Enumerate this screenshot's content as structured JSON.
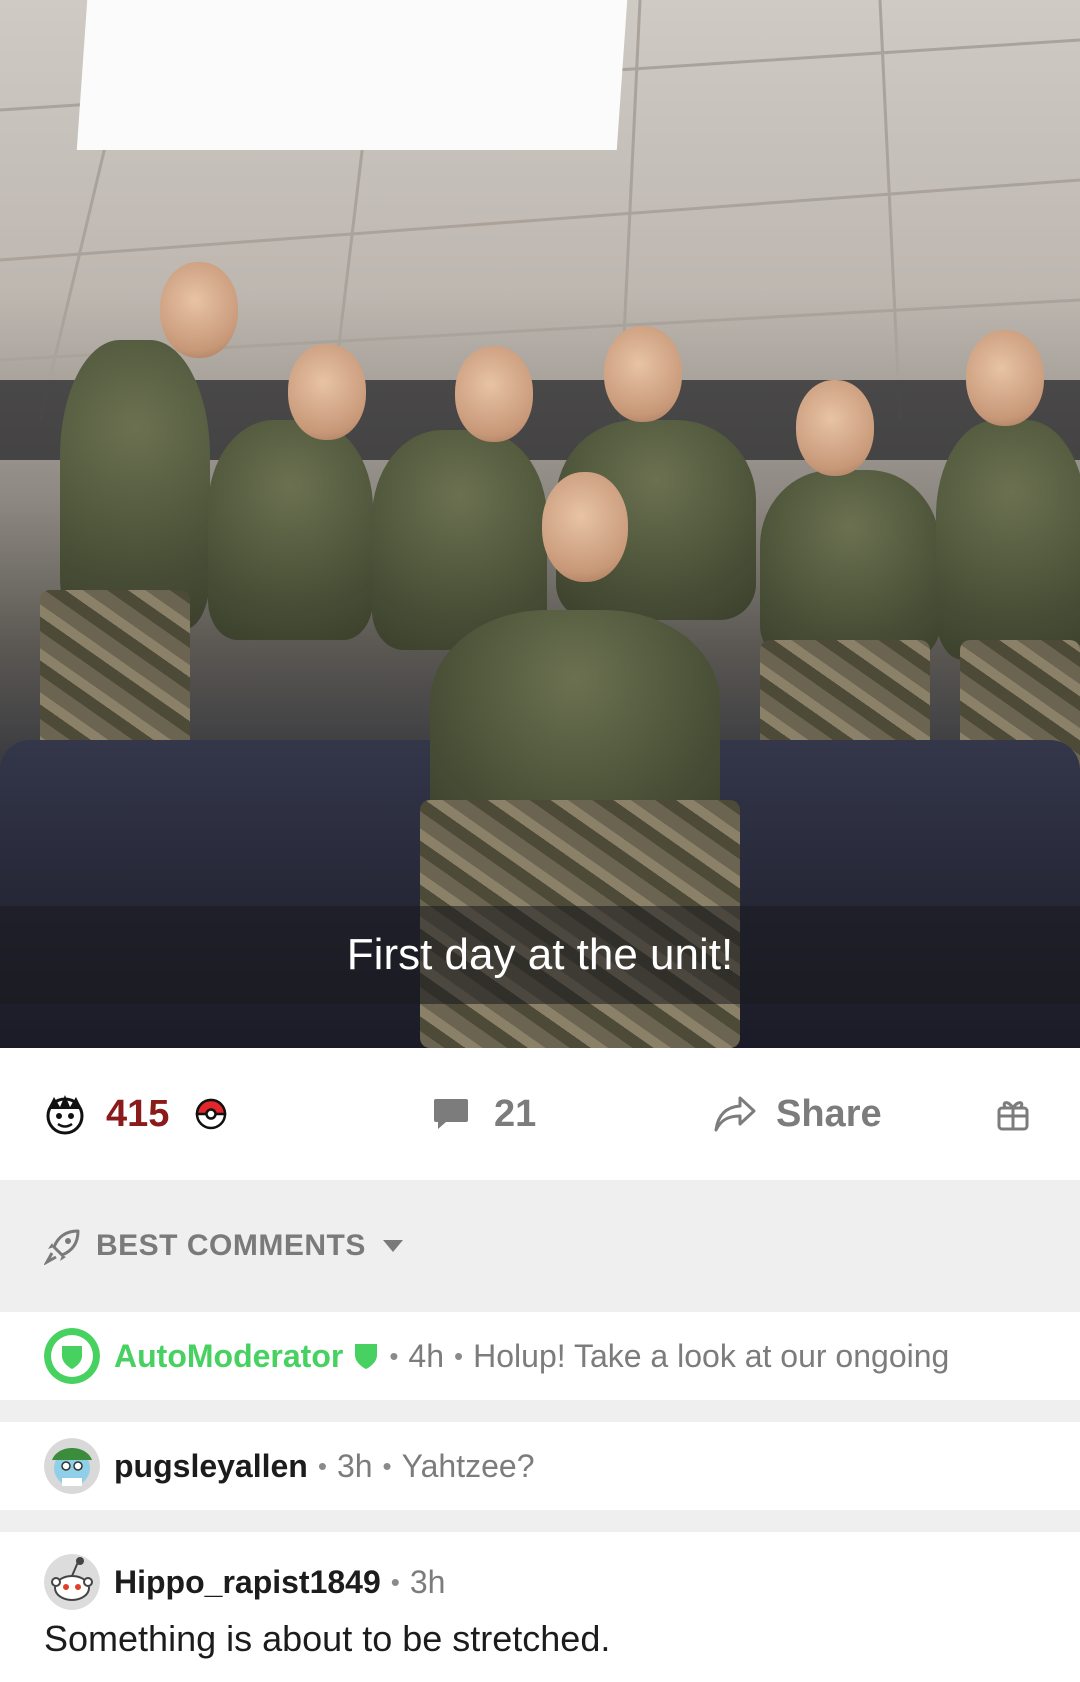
{
  "post": {
    "image_caption": "First day at the unit!"
  },
  "actions": {
    "upvote_count": "415",
    "comment_count": "21",
    "share_label": "Share",
    "icons": [
      "upvote-avatar-icon",
      "pokeball-icon",
      "comment-icon",
      "share-arrow-icon",
      "gift-icon"
    ]
  },
  "sort": {
    "label": "BEST COMMENTS",
    "icons": [
      "rocket-icon",
      "caret-down-icon"
    ]
  },
  "comments": [
    {
      "author": "AutoModerator",
      "time": "4h",
      "text": "Holup! Take a look at our ongoing",
      "author_color": "#46d160"
    },
    {
      "author": "pugsleyallen",
      "time": "3h",
      "text": "Yahtzee?"
    },
    {
      "author": "Hippo_rapist1849",
      "time": "3h",
      "text": "Something is about to be stretched."
    }
  ],
  "colors": {
    "vote_count": "#8b1a1a",
    "muted": "#7c7c7c",
    "mod_green": "#46d160",
    "divider": "#efefef"
  }
}
